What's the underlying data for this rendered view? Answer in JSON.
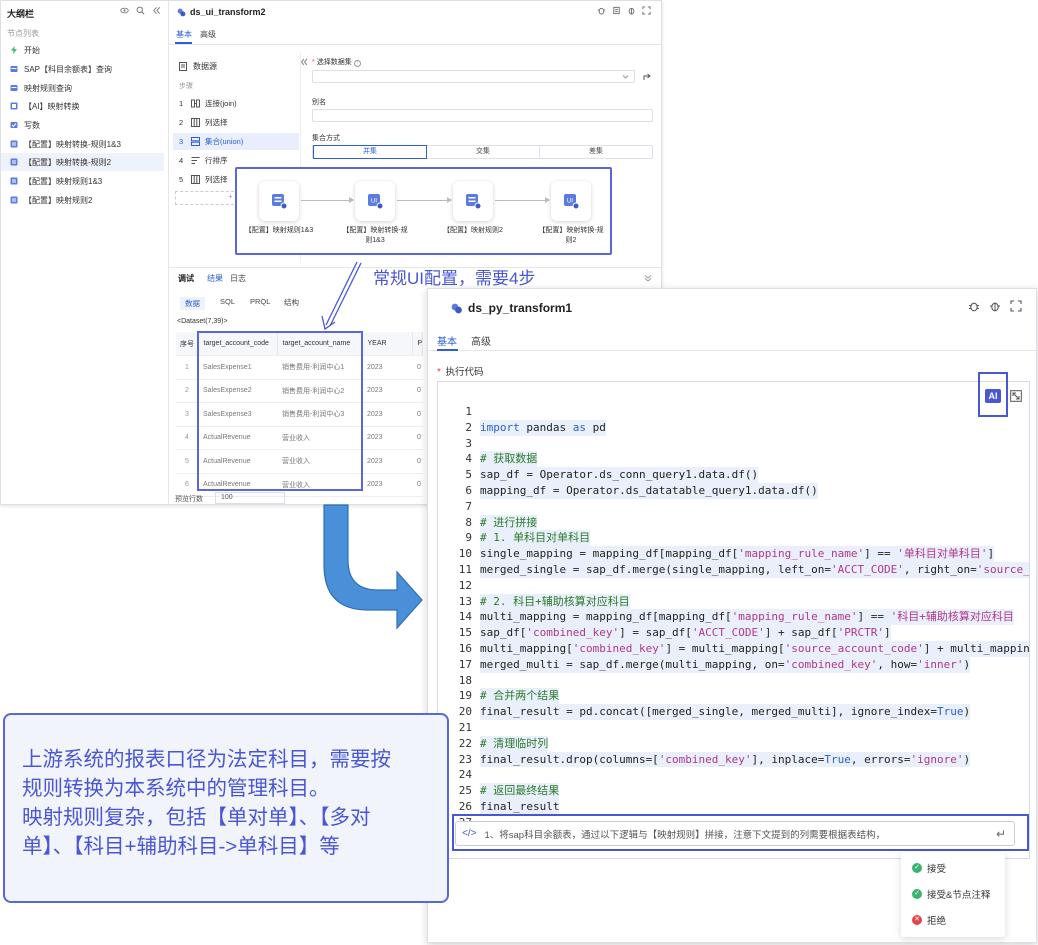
{
  "outline": {
    "title": "大纲栏",
    "section": "节点列表",
    "items": [
      {
        "label": "开始",
        "icon": "lightning-icon",
        "selected": false
      },
      {
        "label": "SAP【科目余额表】查询",
        "icon": "data-source-icon",
        "selected": false
      },
      {
        "label": "映射规则查询",
        "icon": "data-source-icon",
        "selected": false
      },
      {
        "label": "【AI】映射转换",
        "icon": "transform-icon",
        "selected": false
      },
      {
        "label": "写数",
        "icon": "write-icon",
        "selected": false
      },
      {
        "label": "【配置】映射转换-规则1&3",
        "icon": "config-icon",
        "selected": false
      },
      {
        "label": "【配置】映射转换-规则2",
        "icon": "config-icon",
        "selected": true
      },
      {
        "label": "【配置】映射规则1&3",
        "icon": "config-icon",
        "selected": false
      },
      {
        "label": "【配置】映射规则2",
        "icon": "config-icon",
        "selected": false
      }
    ]
  },
  "back_window": {
    "title": "ds_ui_transform2",
    "tabs": [
      "基本",
      "高级"
    ],
    "source_label": "数据源",
    "steps_label": "步骤",
    "steps": [
      {
        "n": "1",
        "label": "连接(join)",
        "selected": false
      },
      {
        "n": "2",
        "label": "列选择",
        "selected": false
      },
      {
        "n": "3",
        "label": "集合(union)",
        "selected": true
      },
      {
        "n": "4",
        "label": "行排序",
        "selected": false
      },
      {
        "n": "5",
        "label": "列选择",
        "selected": false
      }
    ],
    "add_step": "+ 添",
    "form": {
      "dataset_label": "选择数据集",
      "alias_label": "别名",
      "set_mode_label": "集合方式",
      "set_modes": [
        "并集",
        "交集",
        "差集"
      ],
      "active_mode": "并集"
    },
    "flow_nodes": [
      "【配置】映射规则1&3",
      "【配置】映射转换-规则1&3",
      "【配置】映射规则2",
      "【配置】映射转换-规则2"
    ],
    "debug_tabs": [
      "调试",
      "结果",
      "日志"
    ],
    "sub_tabs": [
      "数据",
      "SQL",
      "PRQL",
      "结构"
    ],
    "dataset_info": "<Dataset(7,39)>",
    "table": {
      "columns": [
        "序号",
        "target_account_code",
        "target_account_name",
        "YEAR",
        "P"
      ],
      "rows": [
        [
          "1",
          "SalesExpense1",
          "销售费用-利润中心1",
          "2023",
          "0"
        ],
        [
          "2",
          "SalesExpense2",
          "销售费用-利润中心2",
          "2023",
          "0"
        ],
        [
          "3",
          "SalesExpense3",
          "销售费用-利润中心3",
          "2023",
          "0"
        ],
        [
          "4",
          "ActualRevenue",
          "营业收入",
          "2023",
          "0"
        ],
        [
          "5",
          "ActualRevenue",
          "营业收入",
          "2023",
          "0"
        ],
        [
          "6",
          "ActualRevenue",
          "营业收入",
          "2023",
          "0"
        ]
      ]
    },
    "preview_label": "预览行数",
    "preview_value": "100"
  },
  "annotation_config": "常规UI配置，需要4步",
  "front_window": {
    "title": "ds_py_transform1",
    "tabs": [
      "基本",
      "高级"
    ],
    "code_label": "执行代码",
    "ai_label": "AI",
    "code_lines": [
      "",
      "import pandas as pd",
      "",
      "# 获取数据",
      "sap_df = Operator.ds_conn_query1.data.df()",
      "mapping_df = Operator.ds_datatable_query1.data.df()",
      "",
      "# 进行拼接",
      "# 1. 单科目对单科目",
      "single_mapping = mapping_df[mapping_df['mapping_rule_name'] == '单科目对单科目']",
      "merged_single = sap_df.merge(single_mapping, left_on='ACCT_CODE', right_on='source_",
      "",
      "# 2. 科目+辅助核算对应科目",
      "multi_mapping = mapping_df[mapping_df['mapping_rule_name'] == '科目+辅助核算对应科目",
      "sap_df['combined_key'] = sap_df['ACCT_CODE'] + sap_df['PRCTR']",
      "multi_mapping['combined_key'] = multi_mapping['source_account_code'] + multi_mappin",
      "merged_multi = sap_df.merge(multi_mapping, on='combined_key', how='inner')",
      "",
      "# 合并两个结果",
      "final_result = pd.concat([merged_single, merged_multi], ignore_index=True)",
      "",
      "# 清理临时列",
      "final_result.drop(columns=['combined_key'], inplace=True, errors='ignore')",
      "",
      "# 返回最终结果",
      "final_result",
      ""
    ],
    "prompt_text": "1、将sap科目余额表，通过以下逻辑与【映射规则】拼接，注意下文提到的列需要根据表结构，",
    "menu": [
      "接受",
      "接受&节点注释",
      "拒绝"
    ]
  },
  "annotation_main": [
    "上游系统的报表口径为法定科目，需要按",
    "规则转换为本系统中的管理科目。",
    "映射规则复杂，包括【单对单】、【多对",
    "单】、【科目+辅助科目->单科目】等"
  ],
  "colors": {
    "accent": "#2c5fd1",
    "annotation": "#4a57d4",
    "success": "#3cb371",
    "danger": "#e54545"
  }
}
